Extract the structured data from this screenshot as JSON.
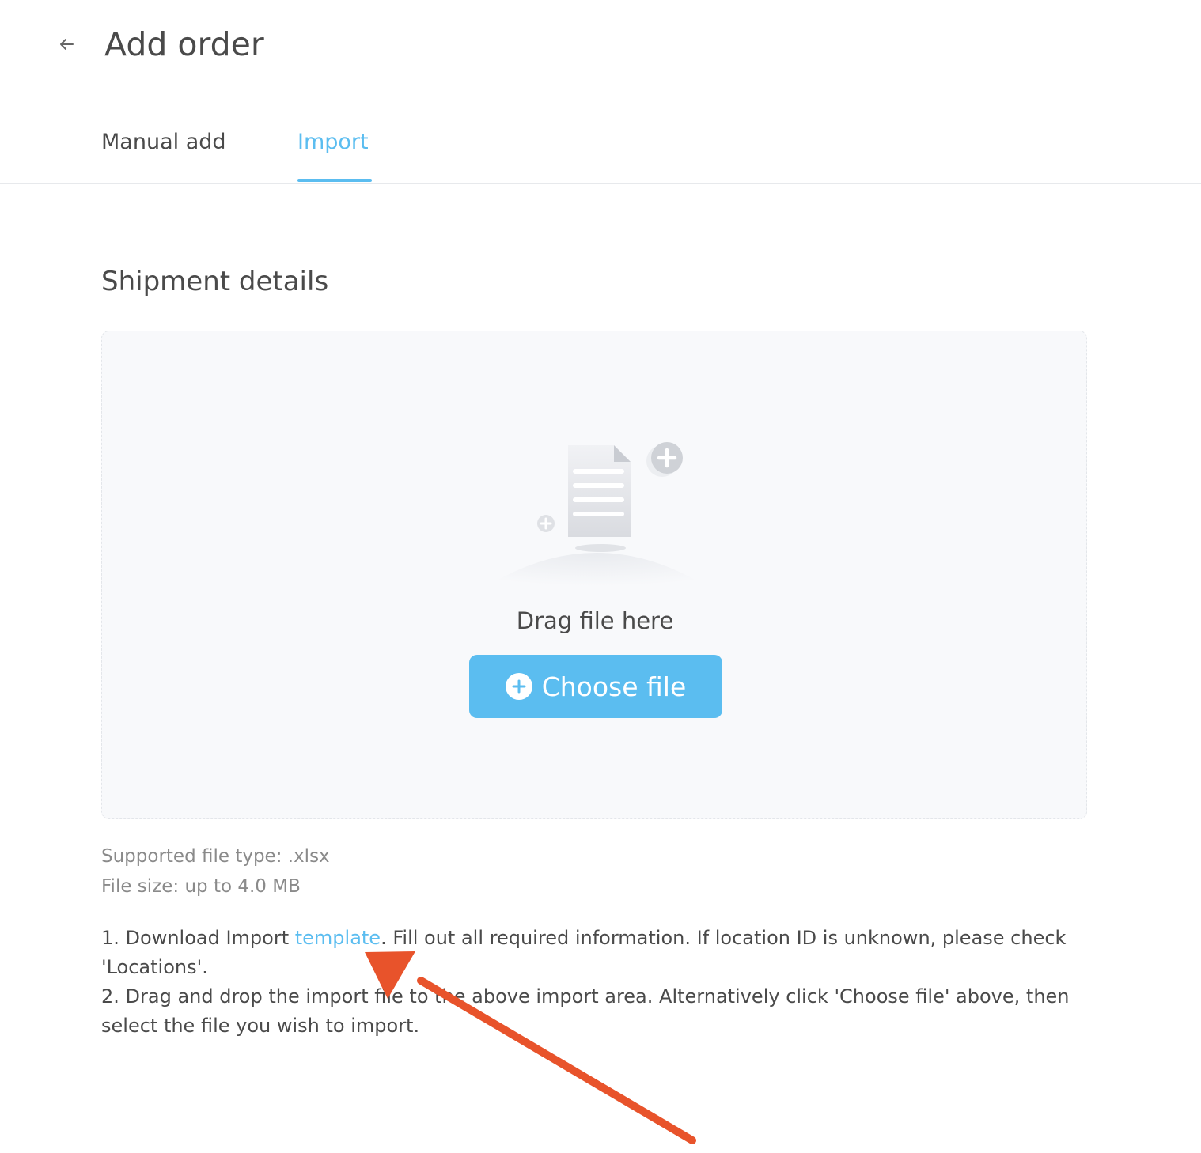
{
  "header": {
    "back_icon": "arrow-left-icon",
    "title": "Add order"
  },
  "tabs": [
    {
      "label": "Manual add",
      "active": false
    },
    {
      "label": "Import",
      "active": true
    }
  ],
  "section": {
    "title": "Shipment details"
  },
  "dropzone": {
    "illustration_icon": "document-upload-icon",
    "drag_text": "Drag file here",
    "choose_button": {
      "icon": "plus-circle-icon",
      "label": "Choose file"
    }
  },
  "file_info": {
    "supported": "Supported file type: .xlsx",
    "size": "File size: up to 4.0 MB"
  },
  "instructions": {
    "step1_prefix": "1. Download Import ",
    "step1_link": "template",
    "step1_suffix": ". Fill out all required information. If location ID is unknown, please check 'Locations'.",
    "step2": "2. Drag and drop the import file to the above import area. Alternatively click 'Choose file' above, then select the file you wish to import."
  },
  "colors": {
    "accent": "#5bbdf0",
    "annotation": "#e8532b",
    "text": "#4a4a4a",
    "muted": "#8a8a8a"
  }
}
